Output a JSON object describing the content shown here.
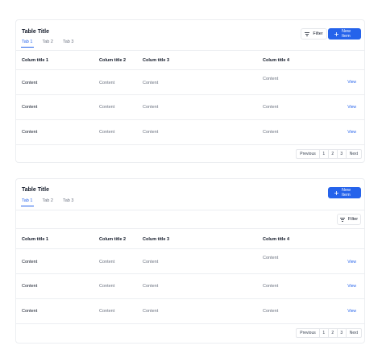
{
  "tables": [
    {
      "title": "Table Title",
      "tabs": [
        "Tab 1",
        "Tab 2",
        "Tab 3"
      ],
      "filter_label": "Filter",
      "new_item_label": "New Item",
      "columns": [
        "Colum title 1",
        "Colum title 2",
        "Colum title 3",
        "Colum title 4"
      ],
      "rows": [
        {
          "c1": "Content",
          "c2": "Content",
          "c3": "Content",
          "c4": "Content",
          "action": "View"
        },
        {
          "c1": "Content",
          "c2": "Content",
          "c3": "Content",
          "c4": "Content",
          "action": "View"
        },
        {
          "c1": "Content",
          "c2": "Content",
          "c3": "Content",
          "c4": "Content",
          "action": "View"
        }
      ],
      "pagination": {
        "previous": "Previous",
        "pages": [
          "1",
          "2",
          "3"
        ],
        "next": "Next"
      }
    },
    {
      "title": "Table Title",
      "tabs": [
        "Tab 1",
        "Tab 2",
        "Tab 3"
      ],
      "filter_label": "Filter",
      "new_item_label": "New Item",
      "columns": [
        "Colum title 1",
        "Colum title 2",
        "Colum title 3",
        "Colum title 4"
      ],
      "rows": [
        {
          "c1": "Content",
          "c2": "Content",
          "c3": "Content",
          "c4": "Content",
          "action": "View"
        },
        {
          "c1": "Content",
          "c2": "Content",
          "c3": "Content",
          "c4": "Content",
          "action": "View"
        },
        {
          "c1": "Content",
          "c2": "Content",
          "c3": "Content",
          "c4": "Content",
          "action": "View"
        }
      ],
      "pagination": {
        "previous": "Previous",
        "pages": [
          "1",
          "2",
          "3"
        ],
        "next": "Next"
      }
    }
  ],
  "colors": {
    "accent": "#2563eb",
    "border": "#eceef1",
    "muted_text": "#6b7280"
  }
}
